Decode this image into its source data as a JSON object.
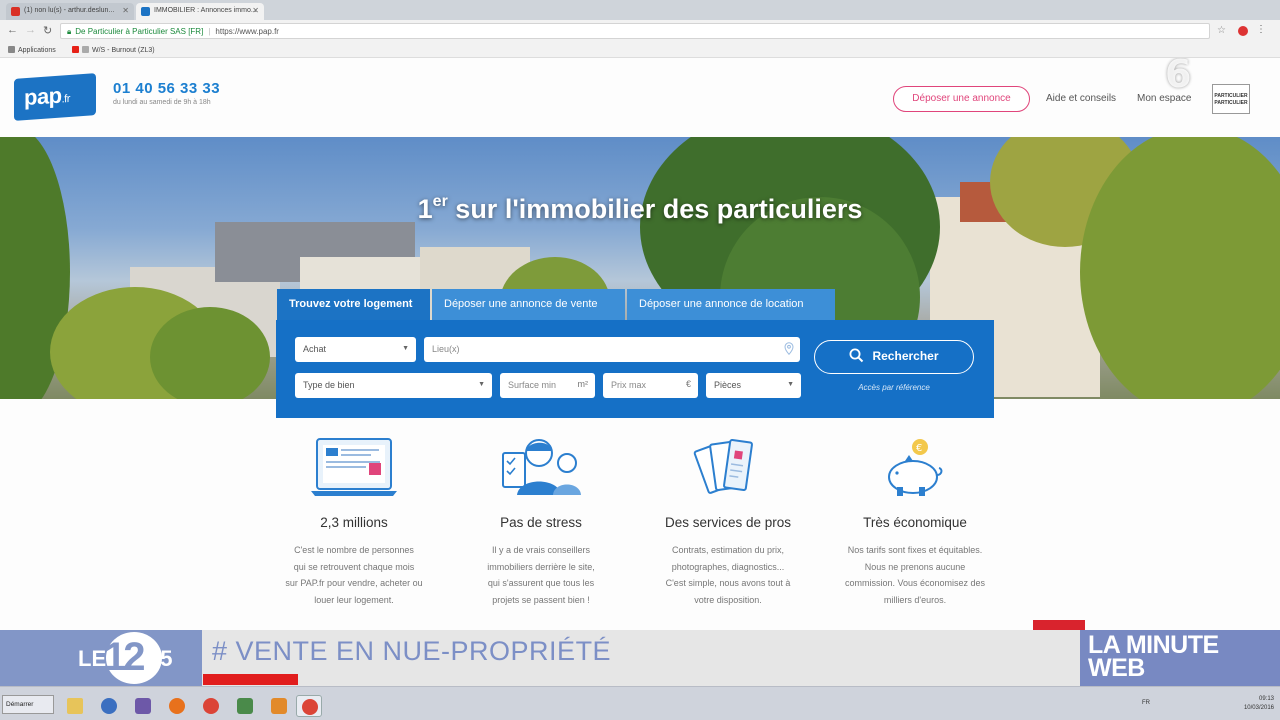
{
  "browser": {
    "tabs": [
      {
        "label": "(1) non lu(s) - arthur.deslun..."
      },
      {
        "label": "IMMOBILIER : Annonces immo..."
      }
    ],
    "site_identity": "De Particulier à Particulier SAS [FR]",
    "url": "https://www.pap.fr",
    "bookmarks": [
      {
        "label": "Applications"
      },
      {
        "label": ""
      },
      {
        "label": "W/S - Burnout (ZL3)"
      }
    ]
  },
  "header": {
    "logo_text": "pap",
    "logo_suffix": ".fr",
    "phone": "01 40 56 33 33",
    "hours": "du lundi au samedi de 9h à 18h",
    "deposit_button": "Déposer une annonce",
    "links": [
      {
        "label": "Aide et conseils"
      },
      {
        "label": "Mon espace"
      }
    ],
    "partner_badge": "PARTICULIER PARTICULIER",
    "channel_logo": "6"
  },
  "hero": {
    "title_prefix": "1",
    "title_sup": "er",
    "title_rest": " sur l'immobilier des particuliers"
  },
  "search": {
    "tabs": [
      {
        "label": "Trouvez votre logement"
      },
      {
        "label": "Déposer une annonce de vente"
      },
      {
        "label": "Déposer une annonce de location"
      }
    ],
    "transaction": "Achat",
    "location_placeholder": "Lieu(x)",
    "property_type": "Type de bien",
    "surface_placeholder": "Surface min",
    "surface_unit": "m²",
    "price_placeholder": "Prix max",
    "price_unit": "€",
    "rooms": "Pièces",
    "search_button": "Rechercher",
    "reference_link": "Accès par référence"
  },
  "features": [
    {
      "title": "2,3 millions",
      "lines": [
        "C'est le nombre de personnes",
        "qui se retrouvent chaque mois",
        "sur PAP.fr pour vendre, acheter ou",
        "louer leur logement."
      ]
    },
    {
      "title": "Pas de stress",
      "lines": [
        "Il y a de vrais conseillers",
        "immobiliers derrière le site,",
        "qui s'assurent que tous les",
        "projets se passent bien !"
      ]
    },
    {
      "title": "Des services de pros",
      "lines": [
        "Contrats, estimation du prix,",
        "photographes, diagnostics...",
        "C'est simple, nous avons tout à",
        "votre disposition."
      ]
    },
    {
      "title": "Très économique",
      "lines": [
        "Nos tarifs sont fixes et équitables.",
        "Nous ne prenons aucune",
        "commission. Vous économisez des",
        "milliers d'euros."
      ]
    }
  ],
  "tv": {
    "le": "LE",
    "hour": "12",
    "minute": "45",
    "headline": "# VENTE EN NUE-PROPRIÉTÉ",
    "segment_line1": "LA MINUTE",
    "segment_line2": "WEB"
  },
  "taskbar": {
    "start_label": "Démarrer",
    "language": "FR",
    "time": "09:13",
    "date": "10/03/2016"
  },
  "colors": {
    "brand_blue": "#1c73c4",
    "accent_pink": "#e0457b",
    "tv_blue": "#7c8fc6",
    "tv_red": "#e11d1d"
  }
}
